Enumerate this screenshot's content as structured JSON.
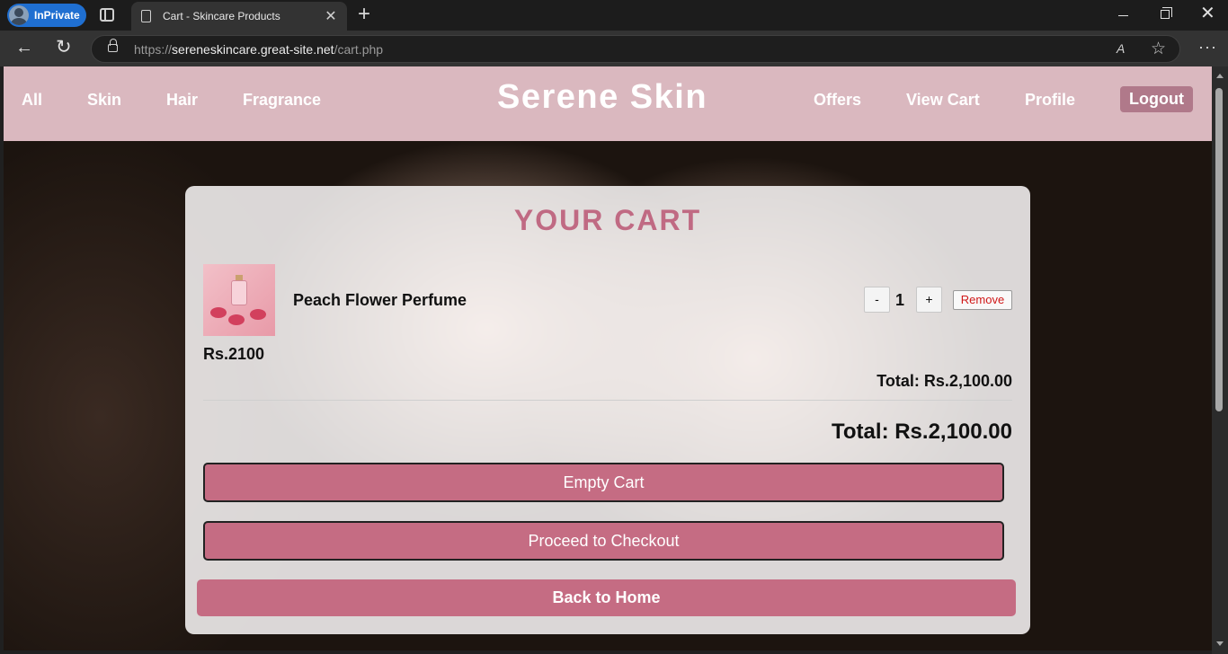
{
  "browser": {
    "inprivate_label": "InPrivate",
    "tab_title": "Cart - Skincare Products",
    "tab_close": "✕",
    "new_tab": "+",
    "url_prefix": "https://",
    "url_host": "sereneskincare.great-site.net",
    "url_path": "/cart.php",
    "read_aloud": "A",
    "favorite": "☆",
    "more": "···",
    "back": "←",
    "refresh": "↻",
    "window_close": "✕"
  },
  "header": {
    "nav_left": [
      "All",
      "Skin",
      "Hair",
      "Fragrance"
    ],
    "brand": "Serene Skin",
    "nav_right": [
      "Offers",
      "View Cart",
      "Profile"
    ],
    "logout": "Logout"
  },
  "cart": {
    "title": "YOUR CART",
    "item": {
      "name": "Peach Flower Perfume",
      "price": "Rs.2100",
      "quantity": "1",
      "minus": "-",
      "plus": "+",
      "remove": "Remove",
      "line_total": "Total: Rs.2,100.00"
    },
    "grand_total": "Total: Rs.2,100.00",
    "empty_cart": "Empty Cart",
    "checkout": "Proceed to Checkout",
    "back_home": "Back to Home"
  },
  "colors": {
    "header_bg": "#dab8bf",
    "accent": "#c56c83",
    "title_color": "#c06a83",
    "logout_bg": "#b0798a",
    "remove_text": "#d01818"
  }
}
